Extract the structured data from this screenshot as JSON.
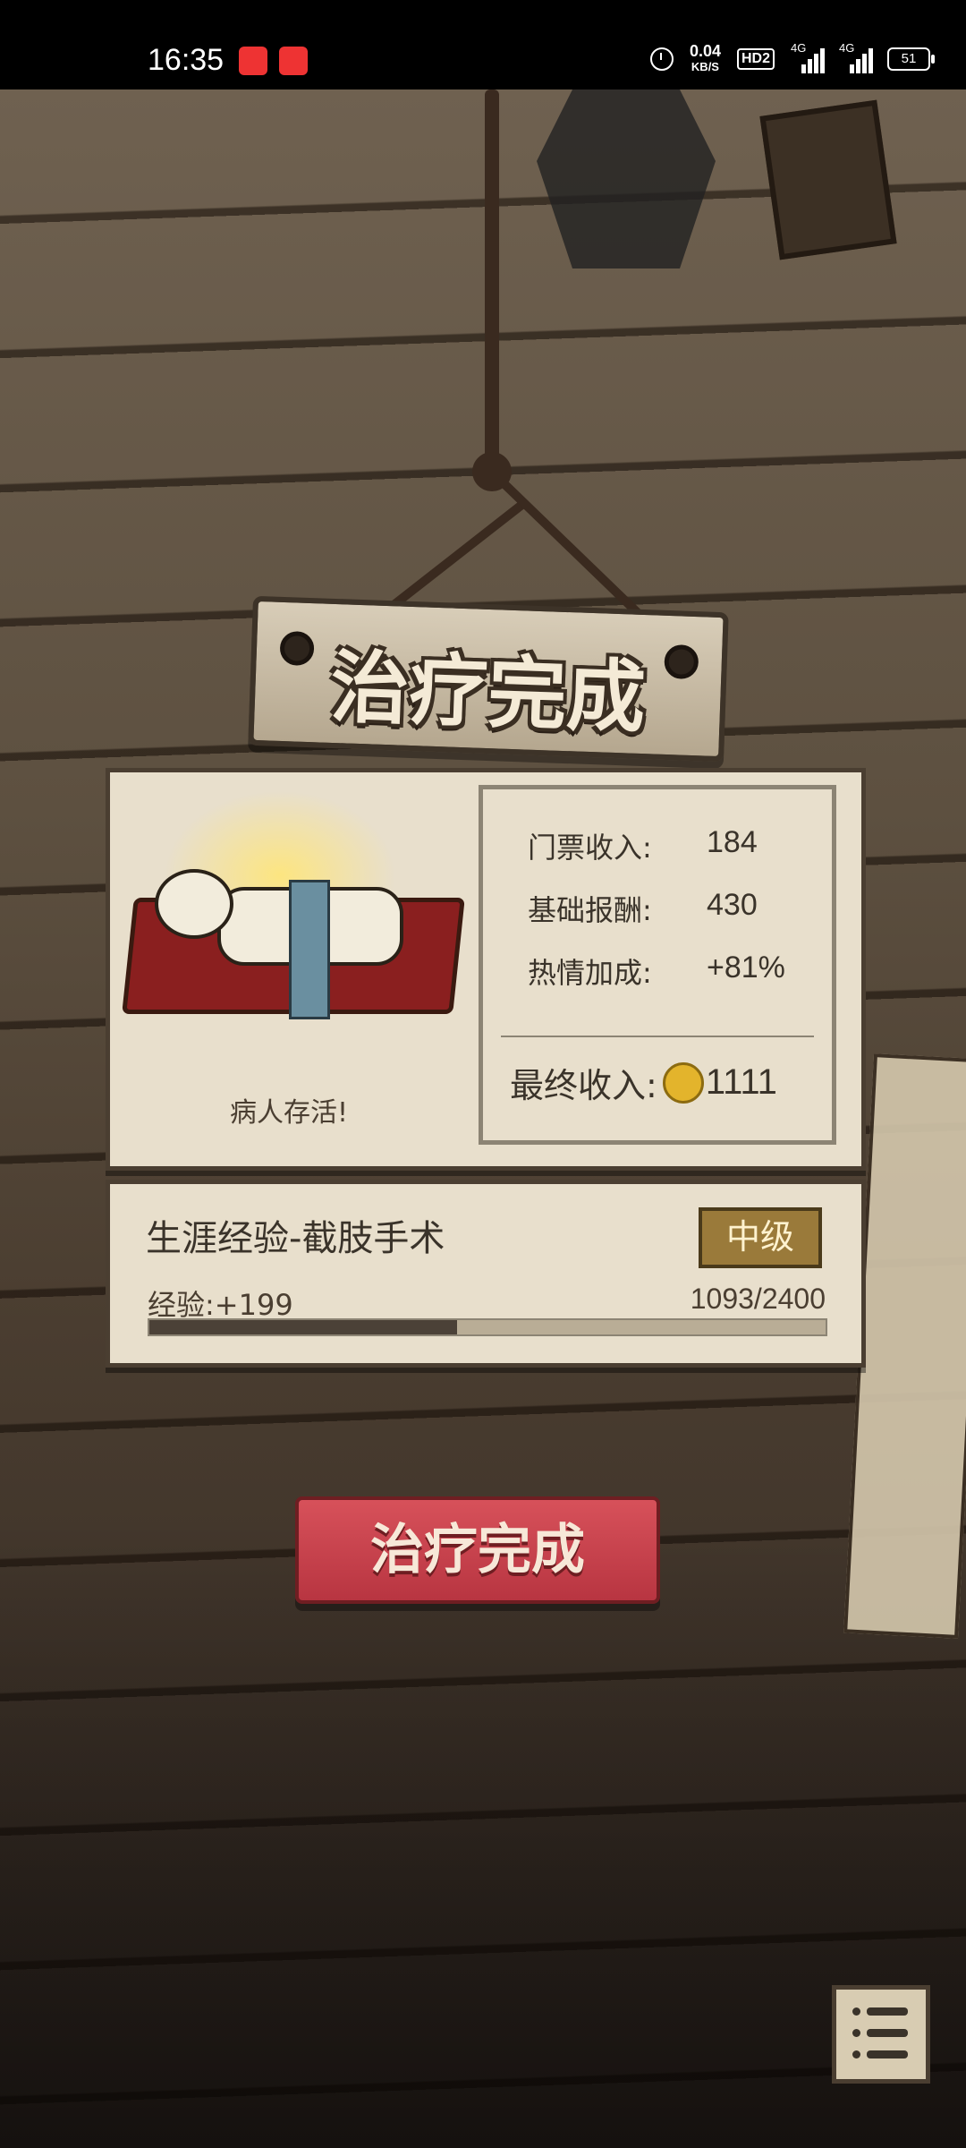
{
  "status_bar": {
    "time": "16:35",
    "net_speed_value": "0.04",
    "net_speed_unit": "KB/S",
    "hd_label": "HD2",
    "signal1_label": "4G",
    "signal2_label": "4G",
    "battery": "51"
  },
  "sign": {
    "title": "治疗完成"
  },
  "result": {
    "patient_status": "病人存活!",
    "stats": [
      {
        "label": "门票收入:",
        "value": "184"
      },
      {
        "label": "基础报酬:",
        "value": "430"
      },
      {
        "label": "热情加成:",
        "value": "+81%"
      }
    ],
    "final_label": "最终收入:",
    "final_value": "1111"
  },
  "experience": {
    "title": "生涯经验-截肢手术",
    "level": "中级",
    "gain": "经验:+199",
    "progress_text": "1093/2400",
    "progress_fraction": 0.455
  },
  "action_button": {
    "label": "治疗完成"
  },
  "menu_button": {
    "icon": "list-icon"
  },
  "colors": {
    "button_red": "#c8434d",
    "panel_paper": "#e8dfcc",
    "level_gold": "#9a7a3a"
  }
}
